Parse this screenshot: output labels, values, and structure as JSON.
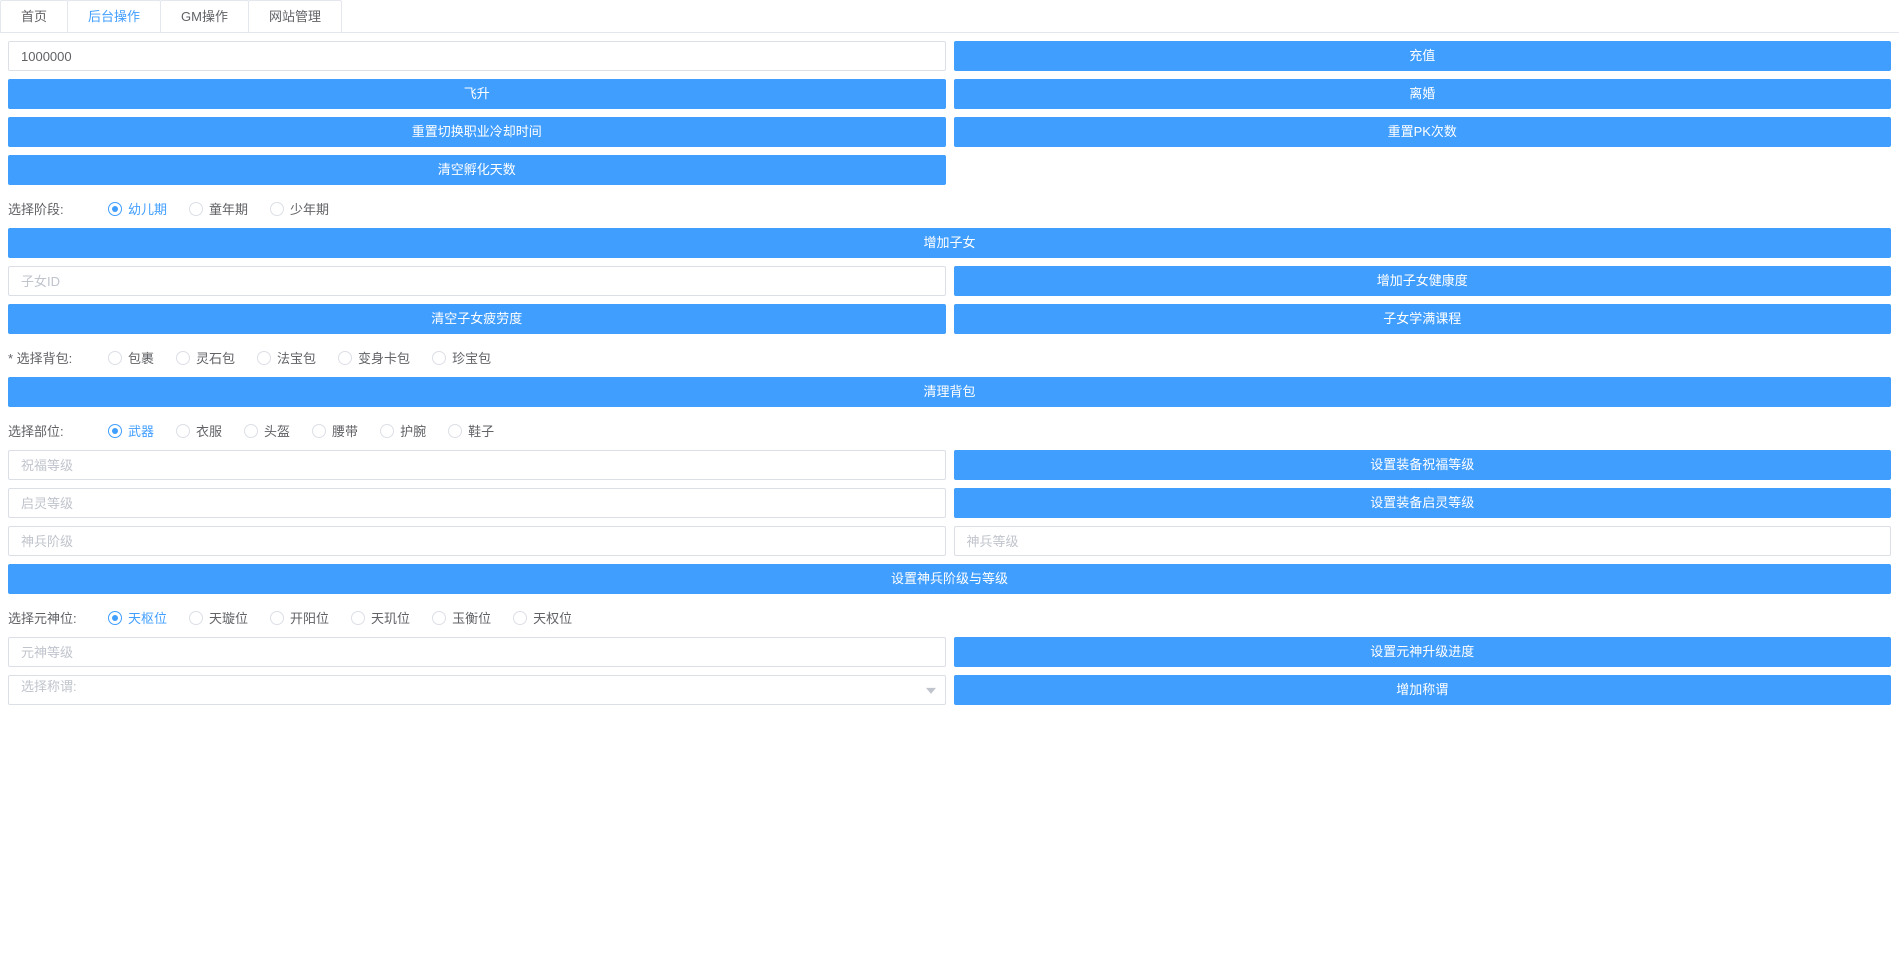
{
  "tabs": {
    "home": "首页",
    "backend": "后台操作",
    "gm": "GM操作",
    "site": "网站管理",
    "active": "backend"
  },
  "inputs": {
    "amount_value": "1000000",
    "child_id_ph": "子女ID",
    "bless_ph": "祝福等级",
    "qiling_ph": "启灵等级",
    "shenbing_stage_ph": "神兵阶级",
    "shenbing_level_ph": "神兵等级",
    "yuanshen_ph": "元神等级",
    "title_select_ph": "选择称谓:"
  },
  "buttons": {
    "recharge": "充值",
    "ascend": "飞升",
    "divorce": "离婚",
    "reset_job_cd": "重置切换职业冷却时间",
    "reset_pk": "重置PK次数",
    "clear_hatch": "清空孵化天数",
    "add_child": "增加子女",
    "add_child_hp": "增加子女健康度",
    "clear_child_fatigue": "清空子女疲劳度",
    "child_full_course": "子女学满课程",
    "clear_bag": "清理背包",
    "set_bless": "设置装备祝福等级",
    "set_qiling": "设置装备启灵等级",
    "set_shenbing": "设置神兵阶级与等级",
    "set_yuanshen": "设置元神升级进度",
    "add_title": "增加称谓"
  },
  "labels": {
    "select_stage": "选择阶段:",
    "select_bag": "选择背包:",
    "select_part": "选择部位:",
    "select_yuanshen": "选择元神位:"
  },
  "radios": {
    "stage": [
      "幼儿期",
      "童年期",
      "少年期"
    ],
    "bag": [
      "包裹",
      "灵石包",
      "法宝包",
      "变身卡包",
      "珍宝包"
    ],
    "part": [
      "武器",
      "衣服",
      "头盔",
      "腰带",
      "护腕",
      "鞋子"
    ],
    "yuanshen": [
      "天枢位",
      "天璇位",
      "开阳位",
      "天玑位",
      "玉衡位",
      "天权位"
    ]
  }
}
